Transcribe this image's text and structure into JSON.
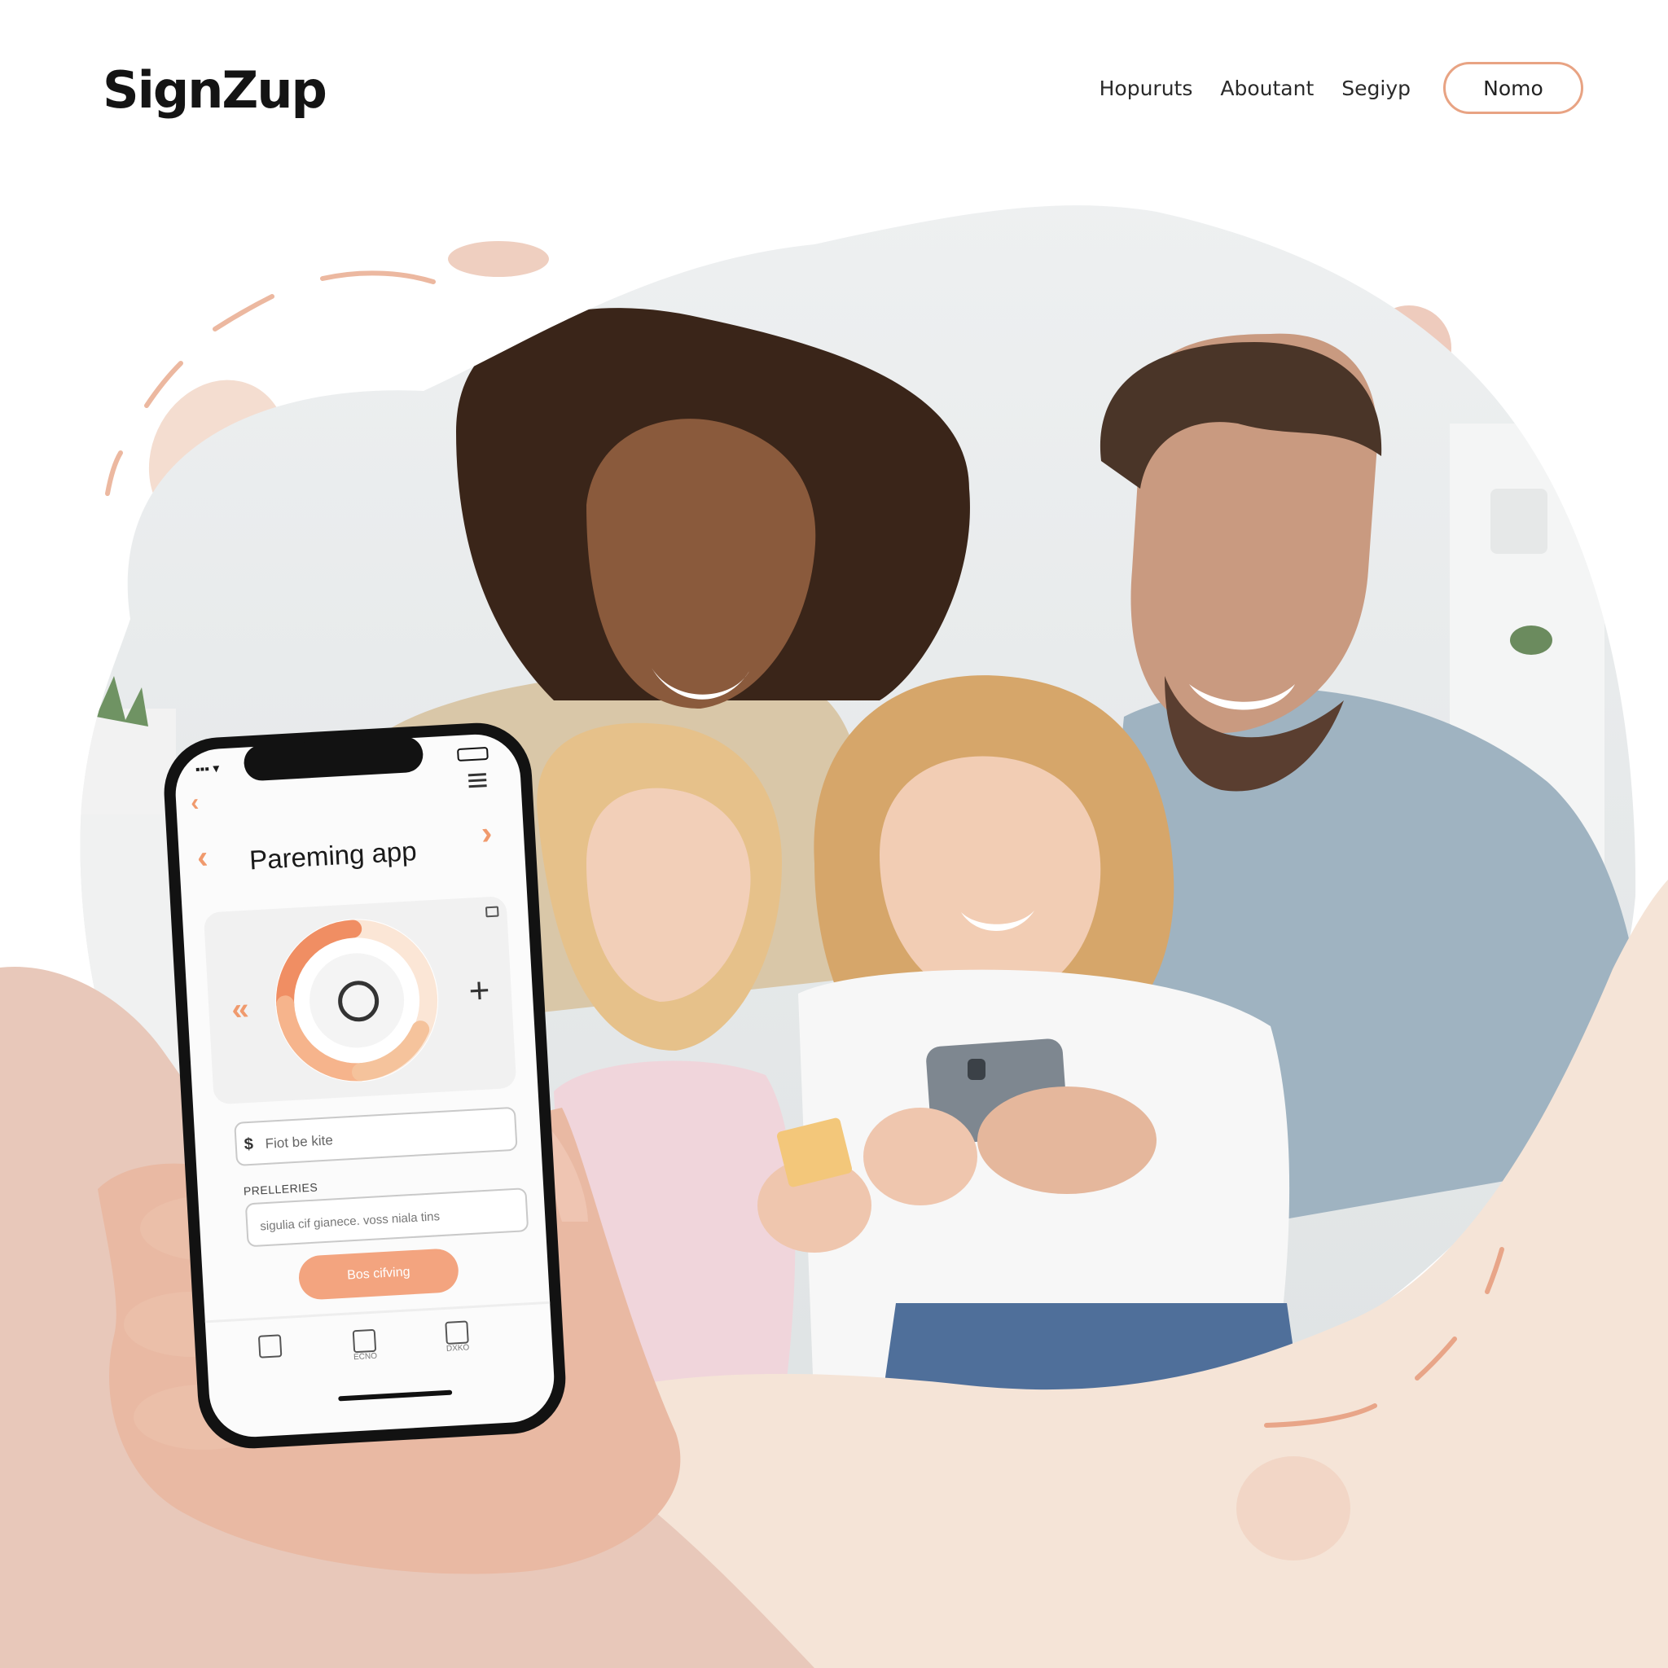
{
  "header": {
    "logo": "SignZup",
    "nav": [
      "Hopuruts",
      "Aboutant",
      "Segiyp"
    ],
    "cta_label": "Nomo"
  },
  "phone": {
    "app_title": "Pareming app",
    "input1_placeholder": "Fiot be kite",
    "section_label": "PRELLERIES",
    "input2_placeholder": "sigulia cif gianece. voss niala tins",
    "primary_button": "Bos cifving",
    "tab_labels": [
      "",
      "ECNO",
      "DXKO"
    ]
  },
  "icons": {
    "back": "chevron-left-icon",
    "next": "chevron-right-icon",
    "menu": "hamburger-menu-icon",
    "add": "plus-icon",
    "timer": "alarm-clock-icon",
    "tab_bag": "shopping-bag-icon",
    "small_badge": "badge-icon"
  },
  "colors": {
    "accent": "#f0a07c",
    "blob_pink": "#e7c7b9",
    "blob_peach": "#f5e3d6",
    "text": "#1b1b1b"
  }
}
